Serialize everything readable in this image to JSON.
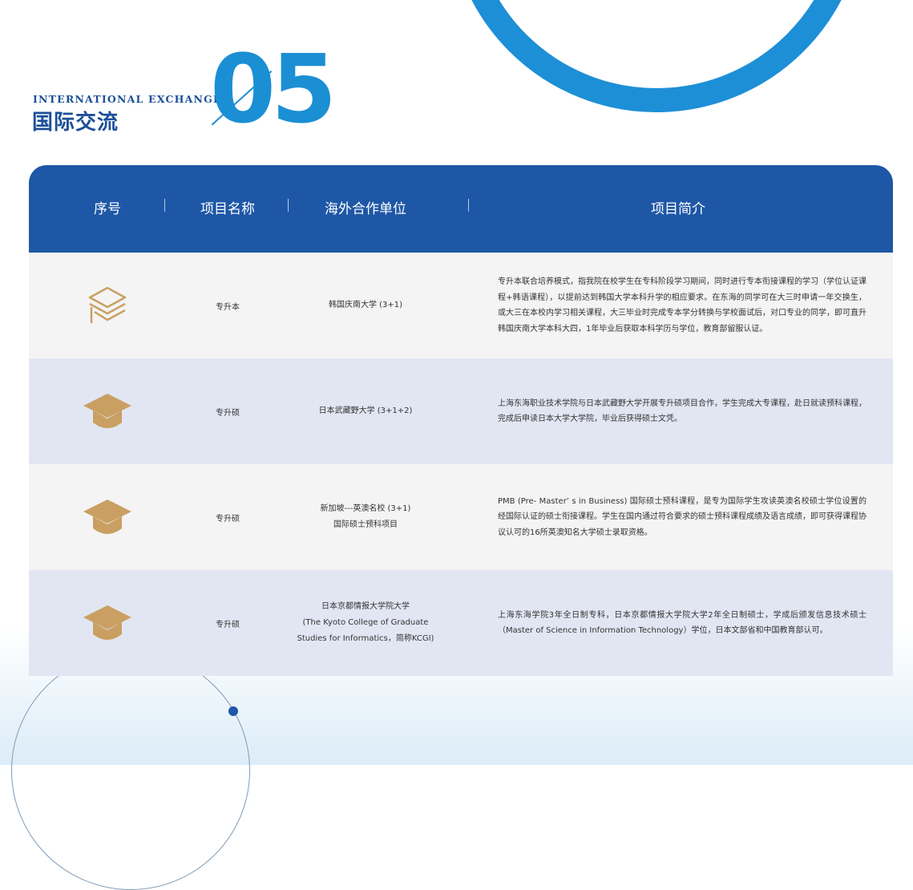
{
  "section": {
    "label_en": "INTERNATIONAL EXCHANGE",
    "label_cn": "国际交流",
    "number": "05"
  },
  "colors": {
    "primary_blue": "#1e57a6",
    "accent_blue": "#1a8fd4",
    "icon_gold": "#c9a062"
  },
  "table": {
    "headers": [
      "序号",
      "项目名称",
      "海外合作单位",
      "项目简介"
    ],
    "rows": [
      {
        "icon": "graduation-scroll-icon",
        "type": "专升本",
        "partner_lines": [
          "韩国庆南大学 (3+1)"
        ],
        "description": "专升本联合培养模式，指我院在校学生在专科阶段学习期间，同时进行专本衔接课程的学习（学位认证课程+韩语课程），以提前达到韩国大学本科升学的相应要求。在东海的同学可在大三时申请一年交换生，或大三在本校内学习相关课程，大三毕业时完成专本学分转换与学校面试后，对口专业的同学，即可直升韩国庆南大学本科大四，1年毕业后获取本科学历与学位，教育部留服认证。"
      },
      {
        "icon": "graduation-cap-icon",
        "type": "专升硕",
        "partner_lines": [
          "日本武藏野大学 (3+1+2)"
        ],
        "description": "上海东海职业技术学院与日本武藏野大学开展专升硕项目合作，学生完成大专课程，赴日就读预科课程，完成后申读日本大学大学院，毕业后获得硕士文凭。"
      },
      {
        "icon": "graduation-cap-icon",
        "type": "专升硕",
        "partner_lines": [
          "新加坡---英澳名校 (3+1)",
          "国际硕士预科项目"
        ],
        "description": "PMB (Pre- Master’ s in Business) 国际硕士预科课程，是专为国际学生攻读英澳名校硕士学位设置的经国际认证的硕士衔接课程。学生在国内通过符合要求的硕士预科课程成绩及语言成绩，即可获得课程协议认可的16所英澳知名大学硕士录取资格。"
      },
      {
        "icon": "graduation-cap-icon",
        "type": "专升硕",
        "partner_lines": [
          "日本京都情报大学院大学",
          "(The Kyoto College of Graduate",
          "Studies for Informatics，简称KCGI)"
        ],
        "description": "上海东海学院3年全日制专科，日本京都情报大学院大学2年全日制硕士，学成后颁发信息技术硕士（Master of Science in Information Technology）学位，日本文部省和中国教育部认可。"
      }
    ]
  }
}
